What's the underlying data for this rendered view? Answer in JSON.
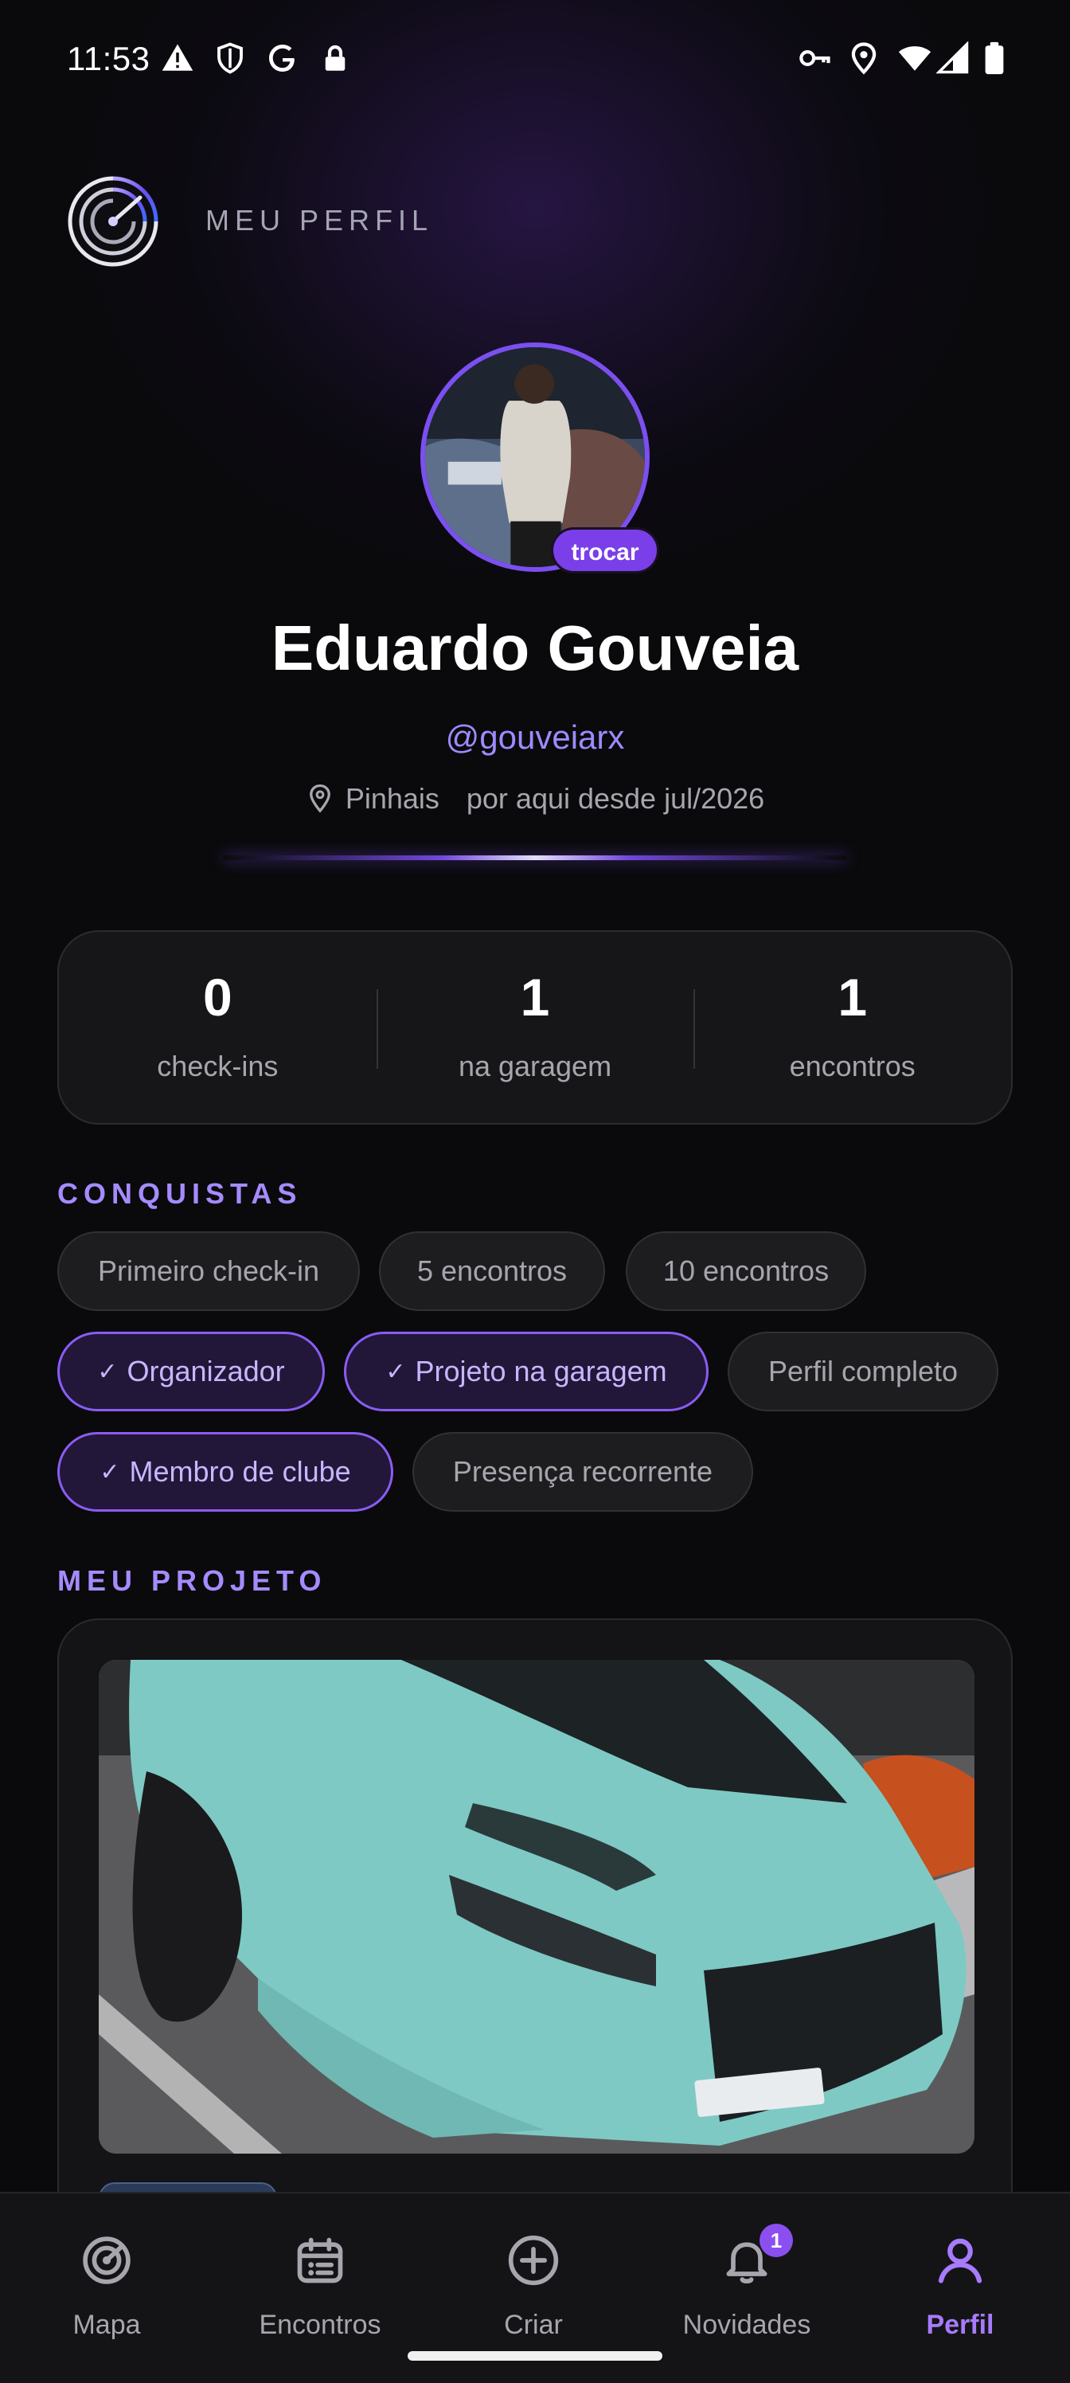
{
  "status_bar": {
    "time": "11:53",
    "icons": [
      "alert-triangle-icon",
      "shield-icon",
      "google-icon",
      "lock-icon",
      "key-icon",
      "location-pin-icon",
      "wifi-icon",
      "signal-icon",
      "battery-icon"
    ]
  },
  "header": {
    "title": "MEU PERFIL",
    "logo_icon": "radar-logo-icon"
  },
  "profile": {
    "change_photo_label": "trocar",
    "name": "Eduardo Gouveia",
    "username": "@gouveiarx",
    "city": "Pinhais",
    "member_since": "por aqui desde jul/2026"
  },
  "stats": [
    {
      "value": "0",
      "label": "check-ins"
    },
    {
      "value": "1",
      "label": "na garagem"
    },
    {
      "value": "1",
      "label": "encontros"
    }
  ],
  "achievements": {
    "title": "CONQUISTAS",
    "items": [
      {
        "label": "Primeiro check-in",
        "earned": false
      },
      {
        "label": "5 encontros",
        "earned": false
      },
      {
        "label": "10 encontros",
        "earned": false
      },
      {
        "label": "Organizador",
        "earned": true
      },
      {
        "label": "Projeto na garagem",
        "earned": true
      },
      {
        "label": "Perfil completo",
        "earned": false
      },
      {
        "label": "Membro de clube",
        "earned": true
      },
      {
        "label": "Presença recorrente",
        "earned": false
      }
    ]
  },
  "project": {
    "title": "MEU PROJETO"
  },
  "bottom_nav": {
    "items": [
      {
        "label": "Mapa",
        "icon": "radar-icon",
        "active": false
      },
      {
        "label": "Encontros",
        "icon": "calendar-icon",
        "active": false
      },
      {
        "label": "Criar",
        "icon": "plus-circle-icon",
        "active": false
      },
      {
        "label": "Novidades",
        "icon": "bell-icon",
        "active": false,
        "badge": "1"
      },
      {
        "label": "Perfil",
        "icon": "user-icon",
        "active": true
      }
    ]
  },
  "colors": {
    "accent": "#8b4ff0",
    "accent_text": "#a58bff",
    "background": "#0a0a0c",
    "card": "#161618"
  }
}
